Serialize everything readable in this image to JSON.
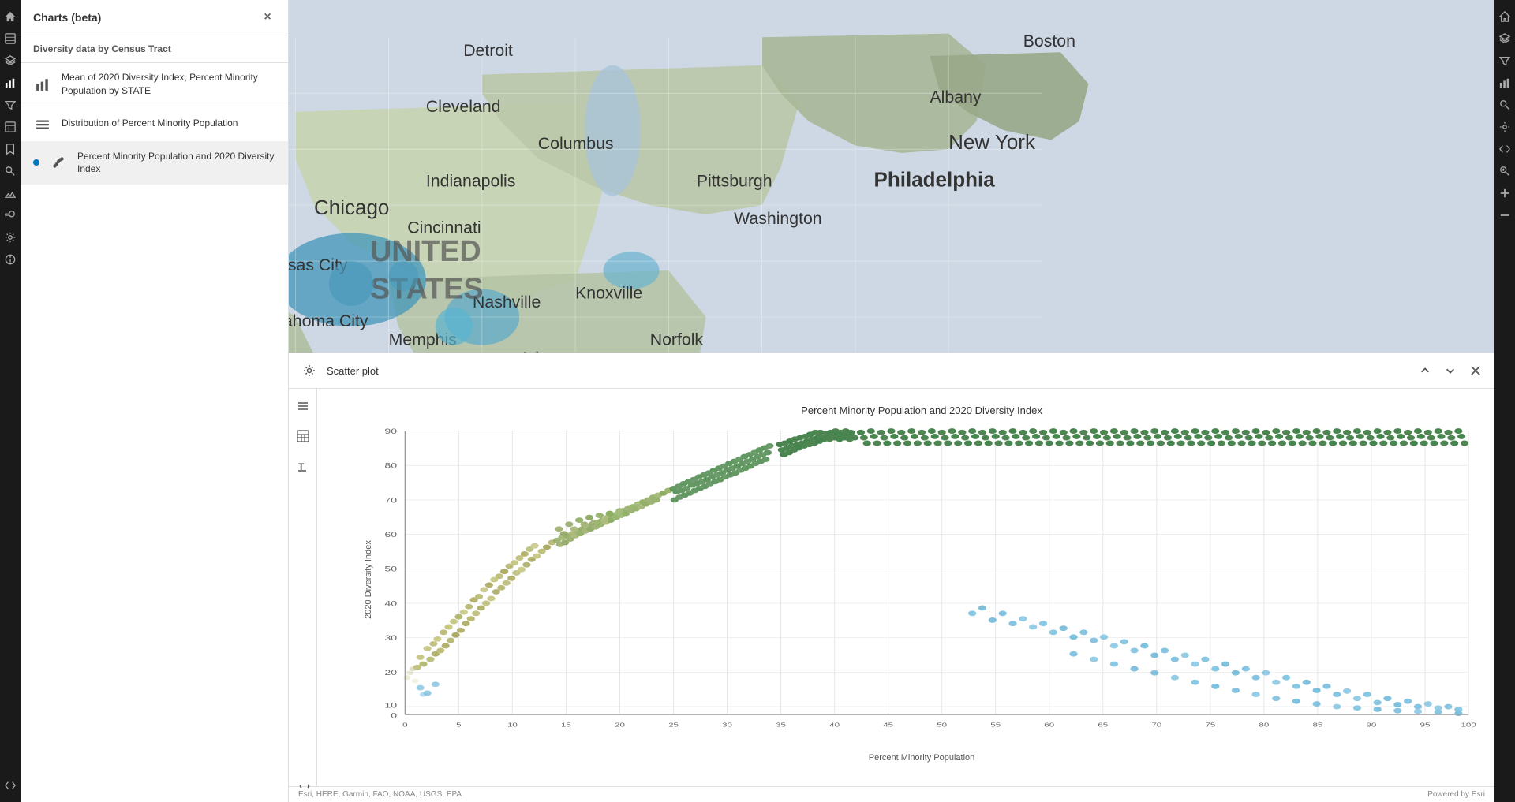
{
  "app": {
    "title": "Charts (beta)",
    "close_label": "×"
  },
  "sidebar": {
    "subtitle": "Diversity data by Census Tract",
    "charts": [
      {
        "id": "chart-1",
        "icon": "bar-chart",
        "label": "Mean of 2020 Diversity Index, Percent Minority Population by STATE",
        "active": false,
        "has_dot": false
      },
      {
        "id": "chart-2",
        "icon": "bar-chart",
        "label": "Distribution of Percent Minority Population",
        "active": false,
        "has_dot": false
      },
      {
        "id": "chart-3",
        "icon": "scatter-chart",
        "label": "Percent Minority Population and 2020 Diversity Index",
        "active": true,
        "has_dot": true
      }
    ]
  },
  "scatter_plot": {
    "title": "Scatter plot",
    "chart_title": "Percent Minority Population and 2020 Diversity Index",
    "x_axis_label": "Percent Minority Population",
    "y_axis_label": "2020 Diversity Index",
    "y_ticks": [
      "0",
      "10",
      "20",
      "30",
      "40",
      "50",
      "60",
      "70",
      "80",
      "90"
    ],
    "x_ticks": [
      "0",
      "5",
      "10",
      "15",
      "20",
      "25",
      "30",
      "35",
      "40",
      "45",
      "50",
      "55",
      "60",
      "65",
      "70",
      "75",
      "80",
      "85",
      "90",
      "95",
      "100"
    ]
  },
  "toolbar": {
    "settings_icon": "⚙",
    "list_icon": "≡",
    "table_icon": "⊞",
    "format_icon": "T",
    "expand_icon": "»",
    "chevron_up": "∧",
    "chevron_down": "∨",
    "close_icon": "×"
  },
  "right_toolbar": {
    "icons": [
      "home",
      "layers",
      "filter",
      "chart",
      "search",
      "settings",
      "expand",
      "zoom",
      "plus",
      "minus"
    ]
  },
  "map": {
    "attribution": "Esri, HERE, Garmin, FAO, NOAA, USGS, EPA"
  },
  "status_bar": {
    "attribution": "Esri, HERE, Garmin, FAO, NOAA, USGS, EPA",
    "powered_by": "Powered by Esri"
  }
}
